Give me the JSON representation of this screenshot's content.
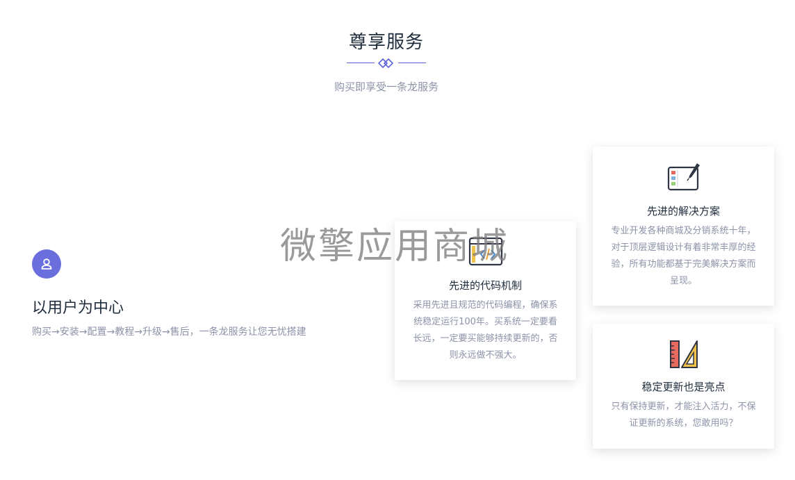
{
  "header": {
    "title": "尊享服务",
    "subtitle": "购买即享受一条龙服务"
  },
  "feature": {
    "title": "以用户为中心",
    "description": "购买→安装→配置→教程→升级→售后，一条龙服务让您无忧搭建"
  },
  "cards": {
    "code": {
      "title": "先进的代码机制",
      "description": "采用先进且规范的代码编程，确保系统稳定运行100年。买系统一定要看长远，一定要买能够持续更新的，否则永远做不强大。",
      "icon": "code-window-icon"
    },
    "solution": {
      "title": "先进的解决方案",
      "description": "专业开发各种商城及分销系统十年，对于顶层逻辑设计有着非常丰厚的经验，所有功能都基于完美解决方案而呈现。",
      "icon": "design-tablet-icon"
    },
    "update": {
      "title": "稳定更新也是亮点",
      "description": "只有保持更新，才能注入活力，不保证更新的系统，您敢用吗？",
      "icon": "ruler-triangle-icon"
    }
  },
  "watermark": "微擎应用商城",
  "colors": {
    "accent": "#6b6fde",
    "title_text": "#1f2d3d",
    "muted_text": "#8c93a8"
  }
}
